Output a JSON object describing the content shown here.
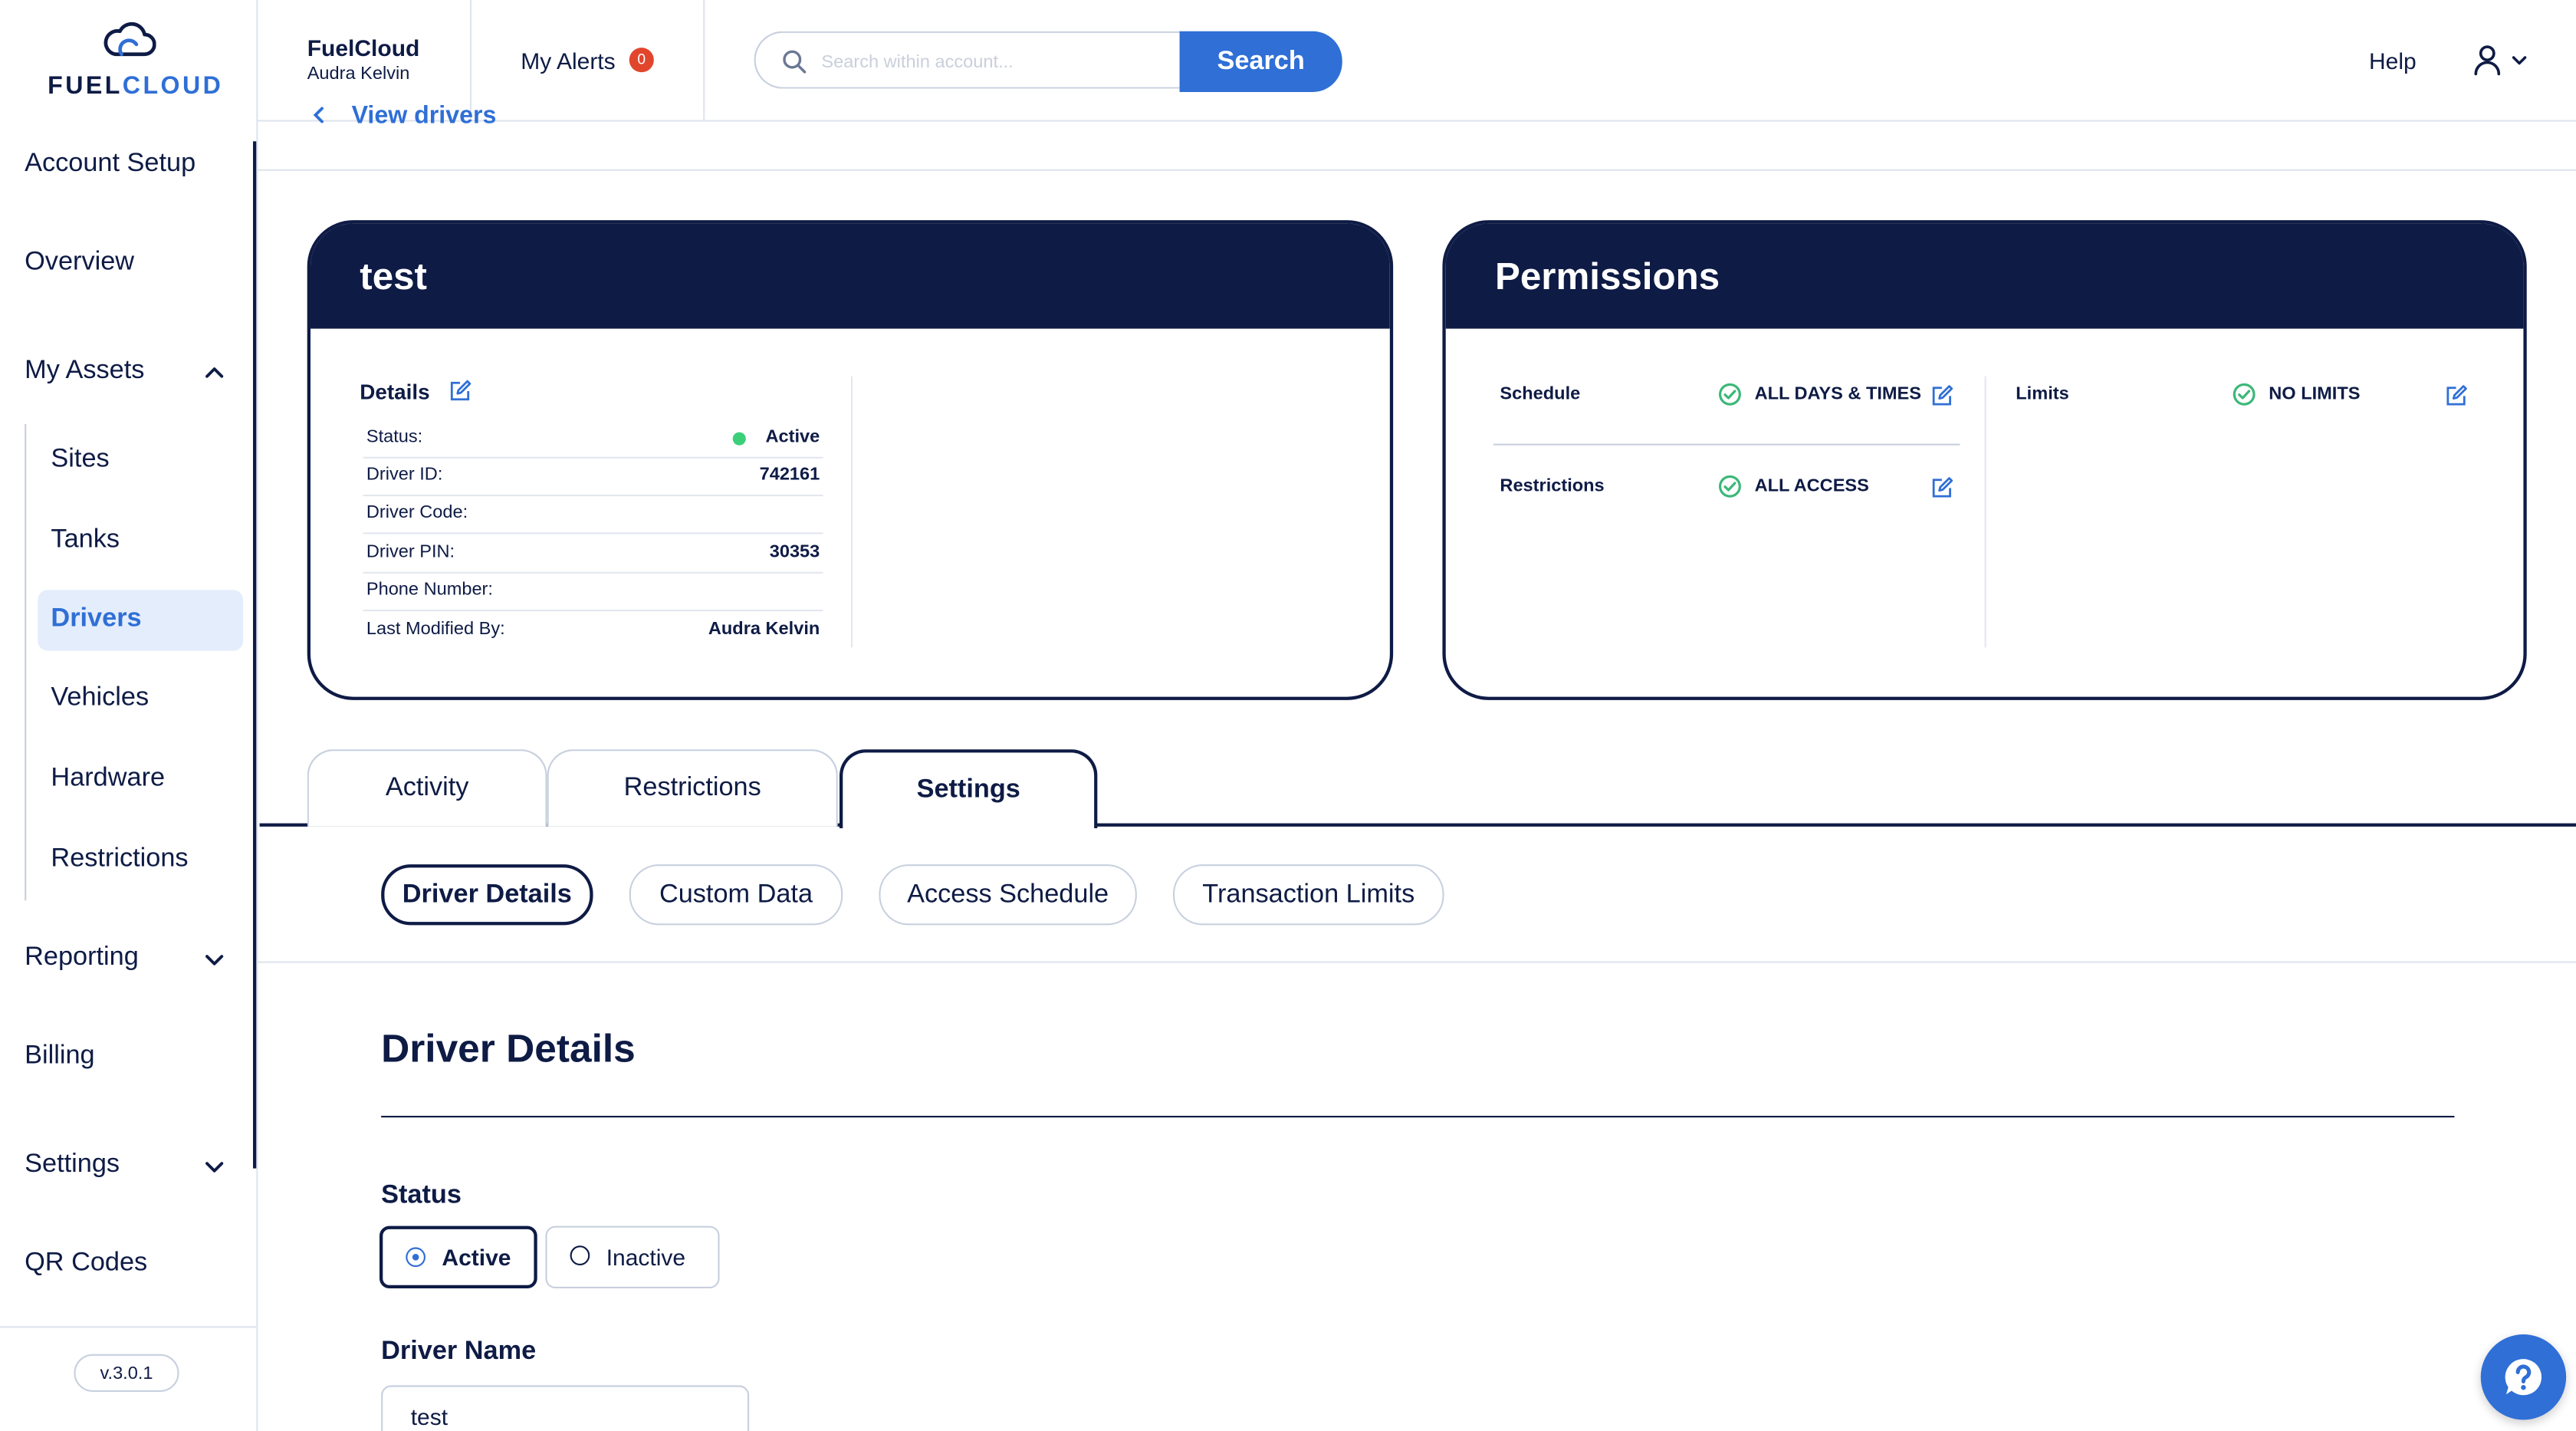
{
  "header": {
    "logo": {
      "word_part1": "FUEL",
      "word_part2": "CLOUD",
      "icon": "cloud-logo-icon"
    },
    "account": {
      "name": "FuelCloud",
      "user": "Audra Kelvin"
    },
    "alerts": {
      "label": "My Alerts",
      "count": "0"
    },
    "search": {
      "placeholder": "Search within account...",
      "value": "",
      "button_label": "Search",
      "icon": "search-icon"
    },
    "help_label": "Help",
    "user_menu_icon": "user-icon"
  },
  "sidebar": {
    "items": [
      {
        "label": "Account Setup"
      },
      {
        "label": "Overview"
      },
      {
        "label": "My Assets",
        "expanded": true,
        "children": [
          {
            "label": "Sites"
          },
          {
            "label": "Tanks"
          },
          {
            "label": "Drivers",
            "active": true
          },
          {
            "label": "Vehicles"
          },
          {
            "label": "Hardware"
          },
          {
            "label": "Restrictions"
          }
        ]
      },
      {
        "label": "Reporting",
        "expanded": false
      },
      {
        "label": "Billing"
      },
      {
        "label": "Settings",
        "expanded": false
      },
      {
        "label": "QR Codes"
      }
    ],
    "version": "v.3.0.1"
  },
  "back_link": "View drivers",
  "driver_card": {
    "title": "test",
    "section_label": "Details",
    "rows": [
      {
        "label": "Status:",
        "value": "Active"
      },
      {
        "label": "Driver ID:",
        "value": "742161"
      },
      {
        "label": "Driver Code:",
        "value": ""
      },
      {
        "label": "Driver PIN:",
        "value": "30353"
      },
      {
        "label": "Phone Number:",
        "value": ""
      },
      {
        "label": "Last Modified By:",
        "value": "Audra Kelvin"
      }
    ]
  },
  "permissions_card": {
    "title": "Permissions",
    "schedule": {
      "label": "Schedule",
      "value": "ALL DAYS & TIMES"
    },
    "restrictions": {
      "label": "Restrictions",
      "value": "ALL ACCESS"
    },
    "limits": {
      "label": "Limits",
      "value": "NO LIMITS"
    }
  },
  "tabs": [
    {
      "label": "Activity"
    },
    {
      "label": "Restrictions"
    },
    {
      "label": "Settings",
      "active": true
    }
  ],
  "subtabs": [
    {
      "label": "Driver Details",
      "active": true
    },
    {
      "label": "Custom Data"
    },
    {
      "label": "Access Schedule"
    },
    {
      "label": "Transaction Limits"
    }
  ],
  "form": {
    "title": "Driver Details",
    "status": {
      "label": "Status",
      "options": [
        "Active",
        "Inactive"
      ],
      "selected": "Active"
    },
    "driver_name": {
      "label": "Driver Name",
      "value": "test"
    }
  },
  "colors": {
    "navy": "#0e1b45",
    "accent_blue": "#2f6fd6",
    "active_nav_bg": "#e4edfb",
    "alert_red": "#e1462d",
    "success_green": "#3cb878",
    "status_active_dot": "#3ccf7a"
  }
}
